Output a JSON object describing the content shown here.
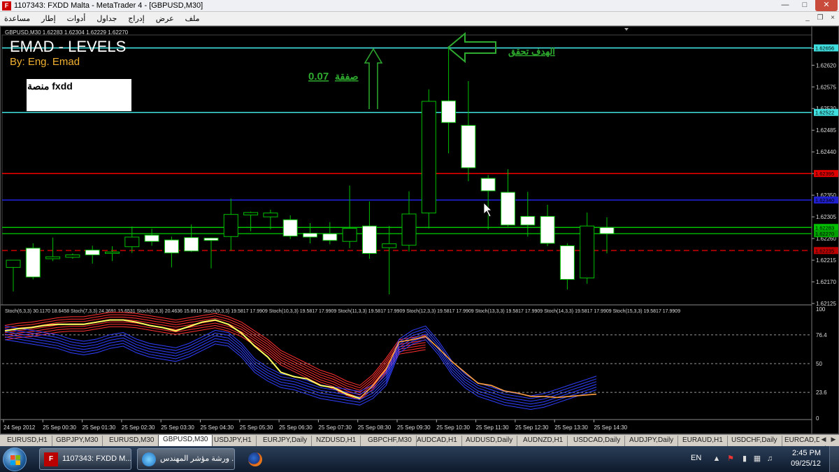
{
  "window": {
    "title": "1107343: FXDD Malta - MetaTrader 4 - [GBPUSD,M30]",
    "app_icon_letter": "F"
  },
  "menu": {
    "items": [
      "ملف",
      "عرض",
      "إدراج",
      "جداول",
      "أدوات",
      "إطار",
      "مساعدة"
    ]
  },
  "chart": {
    "caption": "GBPUSD,M30  1.62283 1.62304 1.62229 1.62270",
    "overlay_title": "EMAD - LEVELS",
    "overlay_author": "By: Eng. Emad",
    "platform_label": "منصة fxdd",
    "trade_lot_label": "صفقة",
    "trade_lot_value": "0.07",
    "target_label": "الهدف تحقق",
    "price_ticks": [
      "1.62655",
      "1.62620",
      "1.62575",
      "1.62530",
      "1.62485",
      "1.62440",
      "1.62395",
      "1.62350",
      "1.62305",
      "1.62260",
      "1.62215",
      "1.62170",
      "1.62125"
    ],
    "level_tags": [
      "1.62656",
      "1.62522",
      "1.62395",
      "1.62340",
      "1.62283",
      "1.62270",
      "1.62235"
    ],
    "stoch_header": "Stoch(6,3,3) 30.1170 18.6458  Stoch(7,3,3) 24.3691 15.6531  Stoch(8,3,3) 20.4636 15.8919  Stoch(9,3,3) 19.5817 17.9909  Stoch(10,3,3) 19.5817 17.9909  Stoch(11,3,3) 19.5817 17.9909  Stoch(12,3,3) 19.5817 17.9909  Stoch(13,3,3) 19.5817 17.9909  Stoch(14,3,3) 19.5817 17.9909  Stoch(15,3,3) 19.5817 17.9909",
    "stoch_ticks": [
      "100",
      "76.4",
      "50",
      "23.6",
      "0"
    ],
    "time_labels": [
      "24 Sep 2012",
      "25 Sep 00:30",
      "25 Sep 01:30",
      "25 Sep 02:30",
      "25 Sep 03:30",
      "25 Sep 04:30",
      "25 Sep 05:30",
      "25 Sep 06:30",
      "25 Sep 07:30",
      "25 Sep 08:30",
      "25 Sep 09:30",
      "25 Sep 10:30",
      "25 Sep 11:30",
      "25 Sep 12:30",
      "25 Sep 13:30",
      "25 Sep 14:30"
    ],
    "colors": {
      "background": "#000000",
      "bull_candle": "#000000",
      "bear_candle": "#ffffff",
      "wick": "#00c000",
      "target_level": "#40e0e0",
      "red_level": "#e00000",
      "blue_level": "#0000e0",
      "green_level": "#00d000",
      "dashed_red": "#d00000",
      "annotation": "#2eab2e",
      "stoch_red": "#ff3030",
      "stoch_blue": "#3040ff",
      "stoch_yellow": "#ffff60",
      "stoch_orange": "#ffa040"
    }
  },
  "chart_data": {
    "type": "candlestick",
    "symbol": "GBPUSD",
    "timeframe": "M30",
    "ylim": [
      1.62125,
      1.6268
    ],
    "candles": [
      {
        "o": 1.622,
        "h": 1.62215,
        "l": 1.6215,
        "c": 1.62215
      },
      {
        "o": 1.6224,
        "h": 1.6225,
        "l": 1.62175,
        "c": 1.6218
      },
      {
        "o": 1.62218,
        "h": 1.62262,
        "l": 1.62213,
        "c": 1.62222
      },
      {
        "o": 1.62221,
        "h": 1.62229,
        "l": 1.62218,
        "c": 1.62226
      },
      {
        "o": 1.62236,
        "h": 1.62245,
        "l": 1.62208,
        "c": 1.62226
      },
      {
        "o": 1.62232,
        "h": 1.62244,
        "l": 1.62213,
        "c": 1.62232
      },
      {
        "o": 1.62243,
        "h": 1.62285,
        "l": 1.6223,
        "c": 1.62263
      },
      {
        "o": 1.62267,
        "h": 1.6228,
        "l": 1.62245,
        "c": 1.62254
      },
      {
        "o": 1.62257,
        "h": 1.62264,
        "l": 1.622,
        "c": 1.6223
      },
      {
        "o": 1.62262,
        "h": 1.62289,
        "l": 1.62232,
        "c": 1.62234
      },
      {
        "o": 1.62261,
        "h": 1.62262,
        "l": 1.62198,
        "c": 1.62256
      },
      {
        "o": 1.62264,
        "h": 1.62343,
        "l": 1.62235,
        "c": 1.6231
      },
      {
        "o": 1.62309,
        "h": 1.62316,
        "l": 1.62275,
        "c": 1.62314
      },
      {
        "o": 1.62305,
        "h": 1.6232,
        "l": 1.62279,
        "c": 1.62313
      },
      {
        "o": 1.62299,
        "h": 1.62308,
        "l": 1.62259,
        "c": 1.62265
      },
      {
        "o": 1.62271,
        "h": 1.62292,
        "l": 1.6225,
        "c": 1.62263
      },
      {
        "o": 1.6227,
        "h": 1.62294,
        "l": 1.62248,
        "c": 1.62256
      },
      {
        "o": 1.62254,
        "h": 1.6237,
        "l": 1.6224,
        "c": 1.62281
      },
      {
        "o": 1.62286,
        "h": 1.62337,
        "l": 1.62218,
        "c": 1.62229
      },
      {
        "o": 1.62241,
        "h": 1.62286,
        "l": 1.62144,
        "c": 1.62249
      },
      {
        "o": 1.62246,
        "h": 1.62358,
        "l": 1.62233,
        "c": 1.62311
      },
      {
        "o": 1.62313,
        "h": 1.6257,
        "l": 1.62281,
        "c": 1.62545
      },
      {
        "o": 1.62546,
        "h": 1.62656,
        "l": 1.62437,
        "c": 1.62501
      },
      {
        "o": 1.62495,
        "h": 1.62587,
        "l": 1.62379,
        "c": 1.62407
      },
      {
        "o": 1.62385,
        "h": 1.62392,
        "l": 1.62279,
        "c": 1.62359
      },
      {
        "o": 1.62356,
        "h": 1.62404,
        "l": 1.62285,
        "c": 1.62288
      },
      {
        "o": 1.62306,
        "h": 1.62357,
        "l": 1.62264,
        "c": 1.62288
      },
      {
        "o": 1.62306,
        "h": 1.6233,
        "l": 1.62244,
        "c": 1.6225
      },
      {
        "o": 1.62245,
        "h": 1.6225,
        "l": 1.62154,
        "c": 1.62175
      },
      {
        "o": 1.62178,
        "h": 1.62314,
        "l": 1.62166,
        "c": 1.62286
      },
      {
        "o": 1.62283,
        "h": 1.62304,
        "l": 1.62229,
        "c": 1.6227
      }
    ],
    "levels": [
      {
        "value": 1.62656,
        "color": "#40e0e0",
        "style": "solid"
      },
      {
        "value": 1.62522,
        "color": "#40e0e0",
        "style": "solid"
      },
      {
        "value": 1.62395,
        "color": "#e00000",
        "style": "solid"
      },
      {
        "value": 1.6234,
        "color": "#2020d0",
        "style": "solid"
      },
      {
        "value": 1.62283,
        "color": "#00c000",
        "style": "solid"
      },
      {
        "value": 1.6227,
        "color": "#00a000",
        "style": "solid"
      },
      {
        "value": 1.62235,
        "color": "#c00000",
        "style": "dashed"
      }
    ],
    "stochastic": {
      "ylim": [
        0,
        100
      ],
      "levels": [
        76.4,
        50,
        23.6
      ],
      "main_series": [
        80,
        82,
        83,
        85,
        86,
        86,
        86,
        88,
        90,
        90,
        88,
        85,
        83,
        80,
        84,
        88,
        90,
        86,
        78,
        66,
        56,
        42,
        38,
        36,
        30,
        28,
        22,
        18,
        30,
        45,
        70,
        72,
        75,
        64,
        52,
        42,
        32,
        30,
        25,
        23,
        20,
        20,
        19,
        20,
        21,
        22
      ],
      "red_upper_series": [
        85,
        87,
        88,
        90,
        92,
        93,
        93,
        95,
        97,
        97,
        96,
        94,
        92,
        90,
        92,
        94,
        96,
        93,
        88,
        80,
        72,
        62,
        56,
        50,
        44,
        40,
        34,
        30,
        40,
        55,
        72,
        74,
        76
      ],
      "blue_lower_series": [
        72,
        70,
        68,
        66,
        64,
        60,
        58,
        60,
        64,
        66,
        60,
        56,
        54,
        52,
        56,
        62,
        68,
        66,
        56,
        42,
        34,
        28,
        26,
        22,
        18,
        16,
        14,
        12,
        18,
        30,
        60,
        68,
        72,
        58,
        40,
        28,
        20,
        16,
        12,
        10,
        8,
        10,
        14,
        18,
        22,
        26
      ]
    }
  },
  "tabs": {
    "items": [
      "EURUSD,H1",
      "GBPJPY,M30",
      "EURUSD,M30",
      "GBPUSD,M30",
      "USDJPY,H1",
      "EURJPY,Daily",
      "NZDUSD,H1",
      "GBPCHF,M30",
      "AUDCAD,H1",
      "AUDUSD,Daily",
      "AUDNZD,H1",
      "USDCAD,Daily",
      "AUDJPY,Daily",
      "EURAUD,H1",
      "USDCHF,Daily",
      "EURCAD,D"
    ],
    "active_index": 3
  },
  "taskbar": {
    "tasks": [
      {
        "label": "1107343: FXDD M...",
        "icon": "fxdd-icon"
      },
      {
        "label": "ورشة مؤشر المهندس ...",
        "icon": "browser-icon"
      },
      {
        "label": "",
        "icon": "firefox-icon"
      }
    ],
    "lang": "EN",
    "time": "2:45 PM",
    "date": "09/25/12"
  }
}
